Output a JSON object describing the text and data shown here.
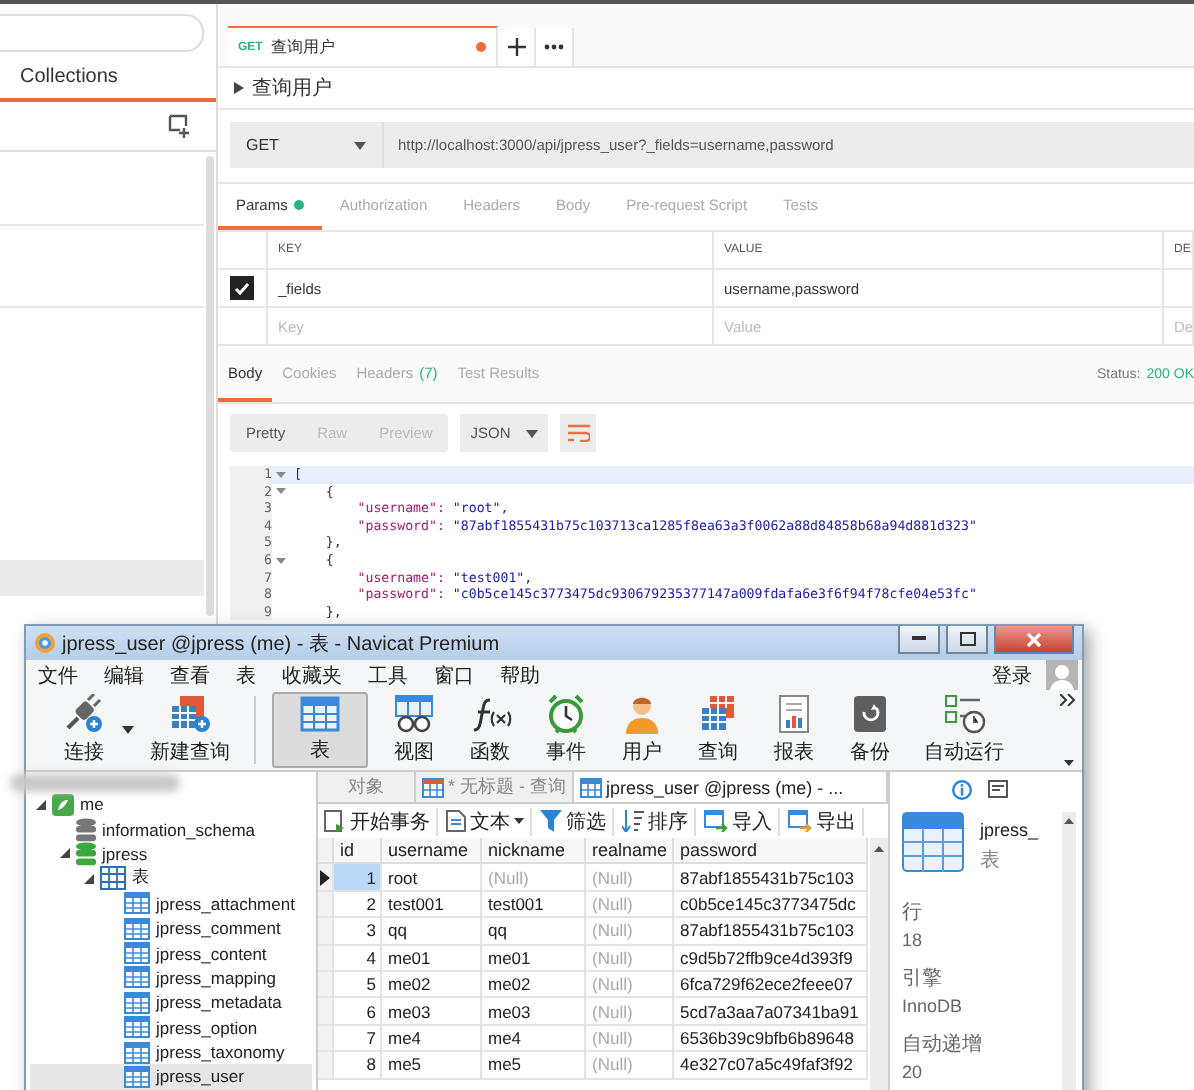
{
  "postman": {
    "sidebar": {
      "tab": "Collections",
      "items": [
        {
          "selected": false
        },
        {
          "selected": false
        },
        {
          "selected": true
        }
      ]
    },
    "request_tab": {
      "method": "GET",
      "title": "查询用户",
      "unsaved": true
    },
    "request_name": "查询用户",
    "method": "GET",
    "url": "http://localhost:3000/api/jpress_user?_fields=username,password",
    "request_tabs": [
      {
        "label": "Params",
        "selected": true,
        "dot": true
      },
      {
        "label": "Authorization",
        "selected": false,
        "dot": false
      },
      {
        "label": "Headers",
        "selected": false,
        "dot": false
      },
      {
        "label": "Body",
        "selected": false,
        "dot": false
      },
      {
        "label": "Pre-request Script",
        "selected": false,
        "dot": false
      },
      {
        "label": "Tests",
        "selected": false,
        "dot": false
      }
    ],
    "params": {
      "columns": [
        "KEY",
        "VALUE",
        "DE"
      ],
      "rows": [
        {
          "key": "_fields",
          "value": "username,password",
          "checked": true
        }
      ],
      "placeholders": [
        "Key",
        "Value",
        "De"
      ]
    },
    "response_tabs": [
      {
        "label": "Body",
        "selected": true
      },
      {
        "label": "Cookies",
        "selected": false
      },
      {
        "label": "Headers",
        "count": "(7)",
        "selected": false
      },
      {
        "label": "Test Results",
        "selected": false
      }
    ],
    "status_label": "Status:",
    "status": "200 OK",
    "view_modes": [
      {
        "label": "Pretty",
        "selected": true
      },
      {
        "label": "Raw",
        "selected": false
      },
      {
        "label": "Preview",
        "selected": false
      }
    ],
    "format": "JSON",
    "code_lines": [
      {
        "no": "1",
        "fold": true,
        "text": "["
      },
      {
        "no": "2",
        "fold": true,
        "text": "    {"
      },
      {
        "no": "3",
        "fold": false,
        "key": "        \"username\": ",
        "value": "\"root\","
      },
      {
        "no": "4",
        "fold": false,
        "key": "        \"password\": ",
        "value": "\"87abf1855431b75c103713ca1285f8ea63a3f0062a88d84858b68a94d881d323\""
      },
      {
        "no": "5",
        "fold": false,
        "text": "    },"
      },
      {
        "no": "6",
        "fold": true,
        "text": "    {"
      },
      {
        "no": "7",
        "fold": false,
        "key": "        \"username\": ",
        "value": "\"test001\","
      },
      {
        "no": "8",
        "fold": false,
        "key": "        \"password\": ",
        "value": "\"c0b5ce145c3773475dc930679235377147a009fdafa6e3f6f94f78cfe04e53fc\""
      },
      {
        "no": "9",
        "fold": false,
        "text": "    },"
      }
    ]
  },
  "navicat": {
    "title": "jpress_user @jpress (me) - 表 - Navicat Premium",
    "menu": [
      "文件",
      "编辑",
      "查看",
      "表",
      "收藏夹",
      "工具",
      "窗口",
      "帮助"
    ],
    "login": "登录",
    "toolbar": [
      {
        "label": "连接",
        "kind": "connect",
        "selected": false,
        "dropdown": true
      },
      {
        "label": "新建查询",
        "kind": "new_query",
        "selected": false
      },
      {
        "label": "表",
        "kind": "table",
        "selected": true
      },
      {
        "label": "视图",
        "kind": "view",
        "selected": false
      },
      {
        "label": "函数",
        "kind": "function",
        "selected": false
      },
      {
        "label": "事件",
        "kind": "event",
        "selected": false
      },
      {
        "label": "用户",
        "kind": "user",
        "selected": false
      },
      {
        "label": "查询",
        "kind": "query",
        "selected": false
      },
      {
        "label": "报表",
        "kind": "report",
        "selected": false
      },
      {
        "label": "备份",
        "kind": "backup",
        "selected": false
      },
      {
        "label": "自动运行",
        "kind": "schedule",
        "selected": false
      }
    ],
    "tree": [
      {
        "label": "me",
        "kind": "connection",
        "expanded": true,
        "selected": false,
        "children": [
          {
            "label": "information_schema",
            "kind": "database",
            "open": false,
            "selected": false
          },
          {
            "label": "jpress",
            "kind": "database",
            "open": true,
            "expanded": true,
            "selected": false,
            "children": [
              {
                "label": "表",
                "kind": "tables",
                "expanded": true,
                "selected": false,
                "children": [
                  {
                    "label": "jpress_attachment",
                    "kind": "table",
                    "selected": false
                  },
                  {
                    "label": "jpress_comment",
                    "kind": "table",
                    "selected": false
                  },
                  {
                    "label": "jpress_content",
                    "kind": "table",
                    "selected": false
                  },
                  {
                    "label": "jpress_mapping",
                    "kind": "table",
                    "selected": false
                  },
                  {
                    "label": "jpress_metadata",
                    "kind": "table",
                    "selected": false
                  },
                  {
                    "label": "jpress_option",
                    "kind": "table",
                    "selected": false
                  },
                  {
                    "label": "jpress_taxonomy",
                    "kind": "table",
                    "selected": false
                  },
                  {
                    "label": "jpress_user",
                    "kind": "table",
                    "selected": true
                  }
                ]
              }
            ]
          }
        ]
      }
    ],
    "object_tabs": [
      {
        "label": "对象",
        "kind": "objects",
        "selected": false
      },
      {
        "label": "* 无标题 - 查询",
        "kind": "query",
        "selected": false
      },
      {
        "label": "jpress_user @jpress (me) - ...",
        "kind": "table",
        "selected": true
      }
    ],
    "grid_toolbar": [
      {
        "label": "开始事务",
        "kind": "transaction"
      },
      {
        "label": "文本",
        "kind": "text",
        "dropdown": true
      },
      {
        "label": "筛选",
        "kind": "filter"
      },
      {
        "label": "排序",
        "kind": "sort"
      },
      {
        "label": "导入",
        "kind": "import"
      },
      {
        "label": "导出",
        "kind": "export"
      }
    ],
    "grid": {
      "columns": [
        "id",
        "username",
        "nickname",
        "realname",
        "password"
      ],
      "rows": [
        {
          "selected": true,
          "cells": [
            {
              "text": "1"
            },
            {
              "text": "root"
            },
            {
              "text": "(Null)",
              "null": true
            },
            {
              "text": "(Null)",
              "null": true
            },
            {
              "text": "87abf1855431b75c103"
            }
          ]
        },
        {
          "selected": false,
          "cells": [
            {
              "text": "2"
            },
            {
              "text": "test001"
            },
            {
              "text": "test001"
            },
            {
              "text": "(Null)",
              "null": true
            },
            {
              "text": "c0b5ce145c3773475dc"
            }
          ]
        },
        {
          "selected": false,
          "cells": [
            {
              "text": "3"
            },
            {
              "text": "qq"
            },
            {
              "text": "qq"
            },
            {
              "text": "(Null)",
              "null": true
            },
            {
              "text": "87abf1855431b75c103"
            }
          ]
        },
        {
          "selected": false,
          "cells": [
            {
              "text": "4"
            },
            {
              "text": "me01"
            },
            {
              "text": "me01"
            },
            {
              "text": "(Null)",
              "null": true
            },
            {
              "text": "c9d5b72ffb9ce4d393f9"
            }
          ]
        },
        {
          "selected": false,
          "cells": [
            {
              "text": "5"
            },
            {
              "text": "me02"
            },
            {
              "text": "me02"
            },
            {
              "text": "(Null)",
              "null": true
            },
            {
              "text": "6fca729f62ece2feee07"
            }
          ]
        },
        {
          "selected": false,
          "cells": [
            {
              "text": "6"
            },
            {
              "text": "me03"
            },
            {
              "text": "me03"
            },
            {
              "text": "(Null)",
              "null": true
            },
            {
              "text": "5cd7a3aa7a07341ba91"
            }
          ]
        },
        {
          "selected": false,
          "cells": [
            {
              "text": "7"
            },
            {
              "text": "me4"
            },
            {
              "text": "me4"
            },
            {
              "text": "(Null)",
              "null": true
            },
            {
              "text": "6536b39c9bfb6b89648"
            }
          ]
        },
        {
          "selected": false,
          "cells": [
            {
              "text": "8"
            },
            {
              "text": "me5"
            },
            {
              "text": "me5"
            },
            {
              "text": "(Null)",
              "null": true
            },
            {
              "text": "4e327c07a5c49faf3f92"
            }
          ]
        }
      ]
    },
    "info": {
      "name": "jpress_",
      "type": "表",
      "props": [
        {
          "label": "行",
          "value": "18"
        },
        {
          "label": "引擎",
          "value": "InnoDB"
        },
        {
          "label": "自动递增",
          "value": "20"
        }
      ]
    }
  }
}
